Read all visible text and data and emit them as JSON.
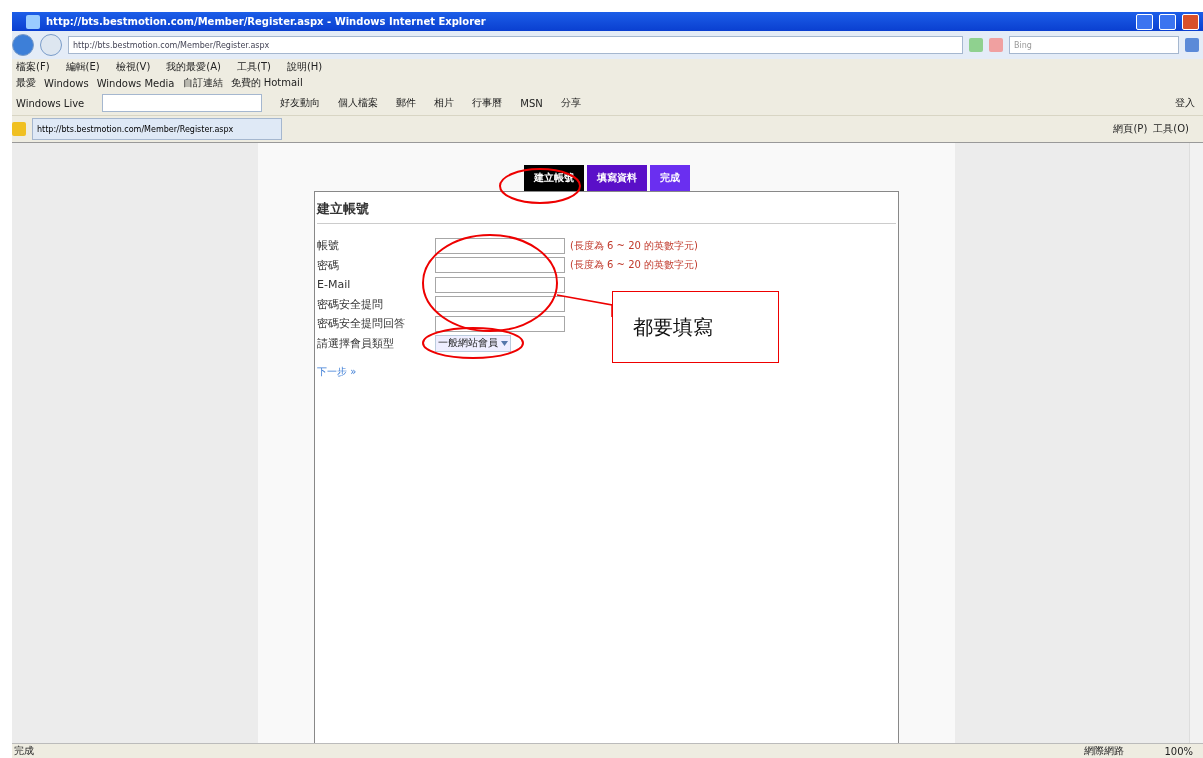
{
  "window": {
    "title": "http://bts.bestmotion.com/Member/Register.aspx - Windows Internet Explorer"
  },
  "address_bar": {
    "url": "http://bts.bestmotion.com/Member/Register.aspx"
  },
  "search": {
    "placeholder": "Bing"
  },
  "menu": [
    "檔案(F)",
    "編輯(E)",
    "檢視(V)",
    "我的最愛(A)",
    "工具(T)",
    "說明(H)"
  ],
  "favorites_bar": {
    "label": "最愛",
    "links": [
      "Windows",
      "Windows Media",
      "自訂連結",
      "免費的 Hotmail"
    ]
  },
  "live_toolbar": {
    "brand": "Windows Live",
    "items": [
      "好友動向",
      "個人檔案",
      "郵件",
      "相片",
      "行事曆",
      "MSN",
      "分享"
    ],
    "sign_in": "登入"
  },
  "browser_tab": {
    "title": "http://bts.bestmotion.com/Member/Register.aspx"
  },
  "command_bar": [
    "網頁(P)",
    "工具(O)"
  ],
  "steps": [
    {
      "label": "建立帳號",
      "selected": true
    },
    {
      "label": "填寫資料",
      "selected": false
    },
    {
      "label": "完成",
      "selected": false
    }
  ],
  "form": {
    "heading": "建立帳號",
    "fields": [
      {
        "label": "帳號",
        "kind": "text",
        "hint": "(長度為 6 ~ 20 的英數字元)"
      },
      {
        "label": "密碼",
        "kind": "password",
        "hint": "(長度為 6 ~ 20 的英數字元)"
      },
      {
        "label": "E-Mail",
        "kind": "text"
      },
      {
        "label": "密碼安全提問",
        "kind": "text"
      },
      {
        "label": "密碼安全提問回答",
        "kind": "text"
      },
      {
        "label": "請選擇會員類型",
        "kind": "select",
        "value": "一般網站會員"
      }
    ],
    "next_link": "下一步 »"
  },
  "annotation": {
    "callout": "都要填寫"
  },
  "status_bar": {
    "text": "完成",
    "zone": "網際網路",
    "zoom": "100%"
  }
}
